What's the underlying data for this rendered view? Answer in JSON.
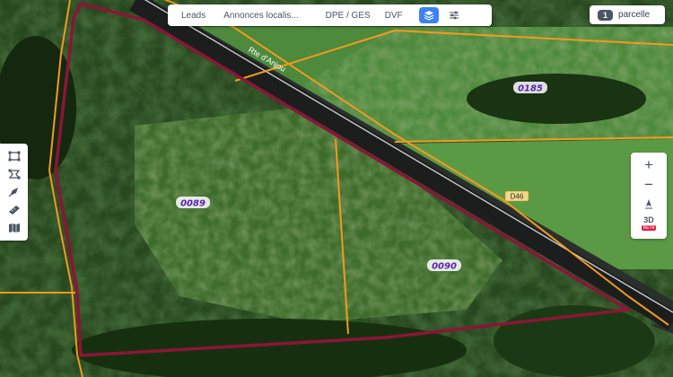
{
  "toolbar": {
    "tabs": [
      {
        "label": "Leads"
      },
      {
        "label": "Annonces localis..."
      },
      {
        "label": "DPE / GES"
      },
      {
        "label": "DVF"
      }
    ],
    "layers_button_icon": "layers-icon",
    "filters_button_icon": "sliders-icon",
    "accent_color": "#3b82f6"
  },
  "parcel_chip": {
    "count": "1",
    "label": "parcelle"
  },
  "map": {
    "road_name": "Rte d'Anjou",
    "road_ref": "D46",
    "parcel_labels": [
      "0089",
      "0090",
      "0185"
    ],
    "selected_parcel_outline_color": "#8b1538",
    "cadastre_line_color": "#f39a1e"
  },
  "left_tools": [
    {
      "icon": "draw-rectangle-icon"
    },
    {
      "icon": "draw-polygon-icon"
    },
    {
      "icon": "pen-tool-icon"
    },
    {
      "icon": "ruler-icon"
    },
    {
      "icon": "map-icon"
    }
  ],
  "right_tools": {
    "zoom_in": "+",
    "zoom_out": "−",
    "compass_icon": "compass-icon",
    "view3d_label": "3D",
    "view3d_badge": "BETA"
  }
}
